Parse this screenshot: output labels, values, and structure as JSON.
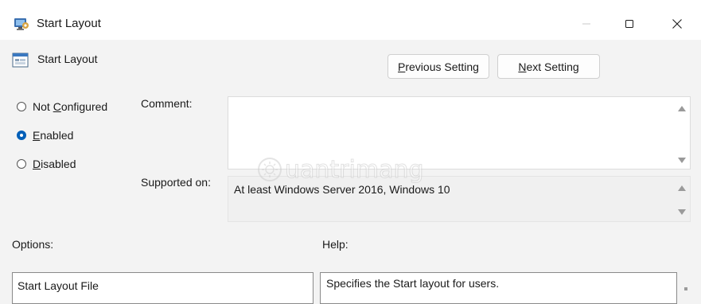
{
  "window": {
    "title": "Start Layout",
    "controls": {
      "minimize": "minimize",
      "maximize": "maximize",
      "close": "close"
    }
  },
  "header": {
    "title": "Start Layout"
  },
  "navigation": {
    "previous": {
      "accel": "P",
      "rest": "revious Setting"
    },
    "next": {
      "accel": "N",
      "rest": "ext Setting"
    }
  },
  "state": {
    "not_configured": {
      "pre": "Not ",
      "accel": "C",
      "rest": "onfigured",
      "checked": false
    },
    "enabled": {
      "pre": "",
      "accel": "E",
      "rest": "nabled",
      "checked": true
    },
    "disabled": {
      "pre": "",
      "accel": "D",
      "rest": "isabled",
      "checked": false
    }
  },
  "labels": {
    "comment": "Comment:",
    "supported_on": "Supported on:",
    "options": "Options:",
    "help": "Help:"
  },
  "comment": {
    "value": ""
  },
  "supported_on": {
    "value": "At least Windows Server 2016, Windows 10"
  },
  "options": {
    "items": [
      "Start Layout File"
    ]
  },
  "help": {
    "text": "Specifies the Start layout for users."
  },
  "watermark": {
    "text": "uantrimang"
  },
  "colors": {
    "accent": "#005fb8",
    "window_bg": "#f3f3f3",
    "titlebar_bg": "#ffffff"
  },
  "icons": {
    "title": "policy-setting-icon",
    "header": "policy-window-icon"
  }
}
